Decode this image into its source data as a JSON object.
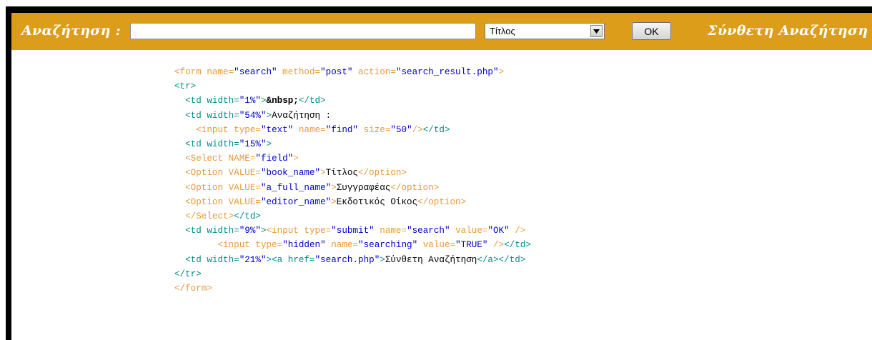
{
  "search_bar": {
    "label": "Αναζήτηση :",
    "input_value": "",
    "select_value": "Τίτλος",
    "ok_label": "OK",
    "advanced_link": "Σύνθετη Αναζήτηση"
  },
  "colors": {
    "bar_background": "#dc9e1a",
    "frame": "#000000",
    "tag": "#008b8b",
    "attribute": "#e69a3a",
    "value": "#0000cd"
  },
  "icons": {
    "select_arrow": "chevron-down-icon"
  },
  "code": {
    "l1": {
      "open": "<form",
      "a1": " name=",
      "v1": "\"search\"",
      "a2": " method=",
      "v2": "\"post\"",
      "a3": " action=",
      "v3": "\"search_result.php\"",
      "close": ">"
    },
    "l2": {
      "tag": "<tr>"
    },
    "l3": {
      "open": "<td",
      "a1": " width=",
      "v1": "\"1%\"",
      "close": ">",
      "text": "&nbsp;",
      "end": "</td>"
    },
    "l4": {
      "open": "<td",
      "a1": " width=",
      "v1": "\"54%\"",
      "close": ">",
      "text": "Αναζήτηση :"
    },
    "l5": {
      "open": "<input",
      "a1": " type=",
      "v1": "\"text\"",
      "a2": " name=",
      "v2": "\"find\"",
      "a3": " size=",
      "v3": "\"50\"",
      "close": "/>",
      "end": "</td>"
    },
    "l6": {
      "open": "<td",
      "a1": " width=",
      "v1": "\"15%\"",
      "close": ">"
    },
    "l7": {
      "open": "<Select",
      "a1": " NAME=",
      "v1": "\"field\"",
      "close": ">"
    },
    "l8": {
      "open": "<Option",
      "a1": " VALUE=",
      "v1": "\"book_name\"",
      "close": ">",
      "text": "Τίτλος",
      "end": "</option>"
    },
    "l9": {
      "open": "<Option",
      "a1": " VALUE=",
      "v1": "\"a_full_name\"",
      "close": ">",
      "text": "Συγγραφέας",
      "end": "</option>"
    },
    "l10": {
      "open": "<Option",
      "a1": " VALUE=",
      "v1": "\"editor_name\"",
      "close": ">",
      "text": "Εκδοτικός Οίκος",
      "end": "</option>"
    },
    "l11": {
      "end1": "</Select>",
      "end2": "</td>"
    },
    "l12": {
      "open": "<td",
      "a1": " width=",
      "v1": "\"9%\"",
      "close": ">",
      "open2": "<input",
      "a2": " type=",
      "v2": "\"submit\"",
      "a3": " name=",
      "v3": "\"search\"",
      "a4": " value=",
      "v4": "\"OK\"",
      "close2": " />"
    },
    "l13": {
      "open": "<input",
      "a1": " type=",
      "v1": "\"hidden\"",
      "a2": " name=",
      "v2": "\"searching\"",
      "a3": " value=",
      "v3": "\"TRUE\"",
      "close": " />",
      "end": "</td>"
    },
    "l14": {
      "open": "<td",
      "a1": " width=",
      "v1": "\"21%\"",
      "close": ">",
      "open2": "<a",
      "a2": " href=",
      "v2": "\"search.php\"",
      "close2": ">",
      "text": "Σύνθετη Αναζήτηση",
      "end": "</a>",
      "end2": "</td>"
    },
    "l15": {
      "tag": "</tr>"
    },
    "l16": {
      "tag": "</form>"
    }
  }
}
